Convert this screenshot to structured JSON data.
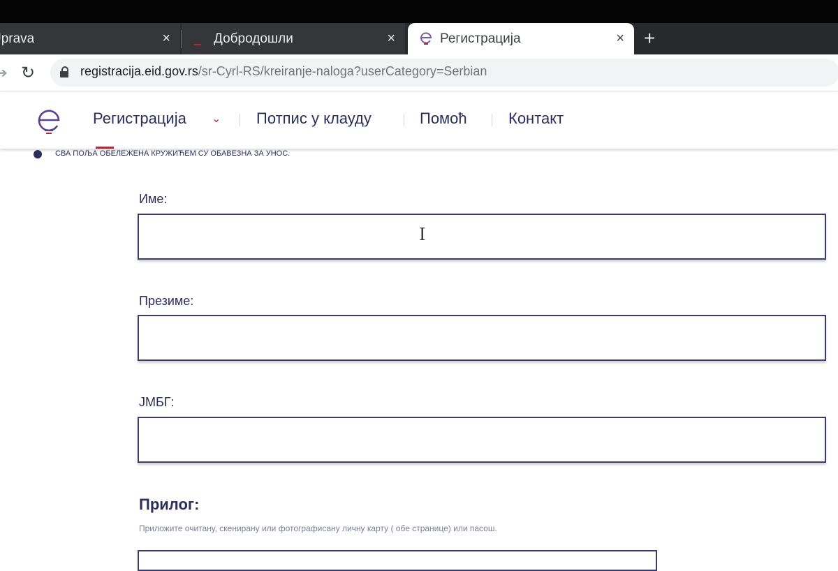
{
  "browser": {
    "tabs": [
      {
        "title": "Uprava",
        "close": "×"
      },
      {
        "title": "Добродошли",
        "close": "×"
      },
      {
        "title": "Регистрација",
        "close": "×"
      }
    ],
    "new_tab": "+",
    "url_host": "registracija.eid.gov.rs",
    "url_path": "/sr-Cyrl-RS/kreiranje-naloga?userCategory=Serbian"
  },
  "site_nav": {
    "items": [
      "Регистрација",
      "Потпис у клауду",
      "Помоћ",
      "Контакт"
    ],
    "active_item": "Регистрација"
  },
  "form": {
    "required_note": "СВА ПОЉА ОБЕЛЕЖЕНА КРУЖИЋЕМ СУ ОБАВЕЗНА ЗА УНОС.",
    "fields": [
      {
        "label": "Име:",
        "value": ""
      },
      {
        "label": "Презиме:",
        "value": ""
      },
      {
        "label": "ЈМБГ:",
        "value": ""
      }
    ],
    "attachment": {
      "title": "Прилог:",
      "hint": "Приложите очитану, скенирану или фотографисану личну карту ( обе странице) или пасош."
    }
  },
  "colors": {
    "brand_navy": "#2b2d5a",
    "accent_red": "#b3263a",
    "tabstrip_bg": "#28292c"
  }
}
